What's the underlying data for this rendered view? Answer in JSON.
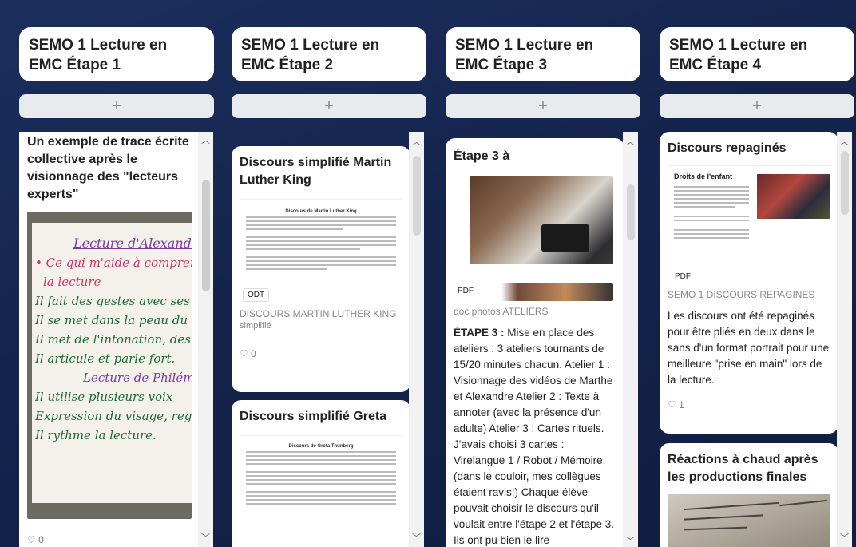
{
  "columns": [
    {
      "title": "SEMO 1 Lecture en EMC Étape 1",
      "add_label": "+",
      "cards": [
        {
          "title": "Un exemple de trace écrite collective après le visionnage des \"lecteurs experts\"",
          "likes": "♡ 0",
          "board_lines": [
            "Lecture d'Alexandre",
            "• Ce qui m'aide à comprendre",
            "la lecture",
            "Il fait des gestes avec ses mains",
            "Il se met dans la peau du perso",
            "Il met de l'intonation, des émo",
            "Il articule et parle fort.",
            "Lecture de Philémon",
            "Il utilise plusieurs voix",
            "Expression du visage, regard",
            "Il rythme la lecture."
          ]
        }
      ]
    },
    {
      "title": "SEMO 1 Lecture en EMC Étape 2",
      "add_label": "+",
      "cards": [
        {
          "title": "Discours simplifié Martin Luther King",
          "doc_heading": "Discours de Martin Luther King",
          "badge": "ODT",
          "sub": "DISCOURS MARTIN LUTHER KING",
          "sub2": "simplifié",
          "likes": "♡ 0"
        },
        {
          "title": "Discours simplifié Greta",
          "doc_heading": "Discours de Greta Thunberg"
        }
      ]
    },
    {
      "title": "SEMO 1 Lecture en EMC Étape 3",
      "add_label": "+",
      "cards": [
        {
          "title": "Étape 3 à",
          "badge": "PDF",
          "sub": "doc photos ATELIERS",
          "body_lead": "ÉTAPE 3 :",
          "body": " Mise en place des ateliers : 3 ateliers tournants de 15/20 minutes chacun. Atelier 1 : Visionnage des vidéos de Marthe et Alexandre Atelier 2 : Texte à annoter (avec la présence d'un adulte) Atelier 3 : Cartes rituels. J'avais choisi 3 cartes : Virelangue 1 / Robot / Mémoire. (dans le couloir, mes collègues étaient ravis!) Chaque élève pouvait choisir le discours qu'il voulait entre l'étape 2 et l'étape 3. Ils ont pu bien le lire"
        }
      ]
    },
    {
      "title": "SEMO 1 Lecture en EMC Étape 4",
      "add_label": "+",
      "cards": [
        {
          "title": "Discours repaginés",
          "doc_heading": "Droits de l'enfant",
          "badge": "PDF",
          "sub": "SEMO 1 DISCOURS REPAGINES",
          "body": "Les discours ont été repaginés pour être pliés en deux dans le sans d'un format portrait pour une meilleure \"prise en main\" lors de la lecture.",
          "likes": "♡ 1"
        },
        {
          "title": "Réactions à chaud après les productions finales"
        }
      ]
    }
  ]
}
